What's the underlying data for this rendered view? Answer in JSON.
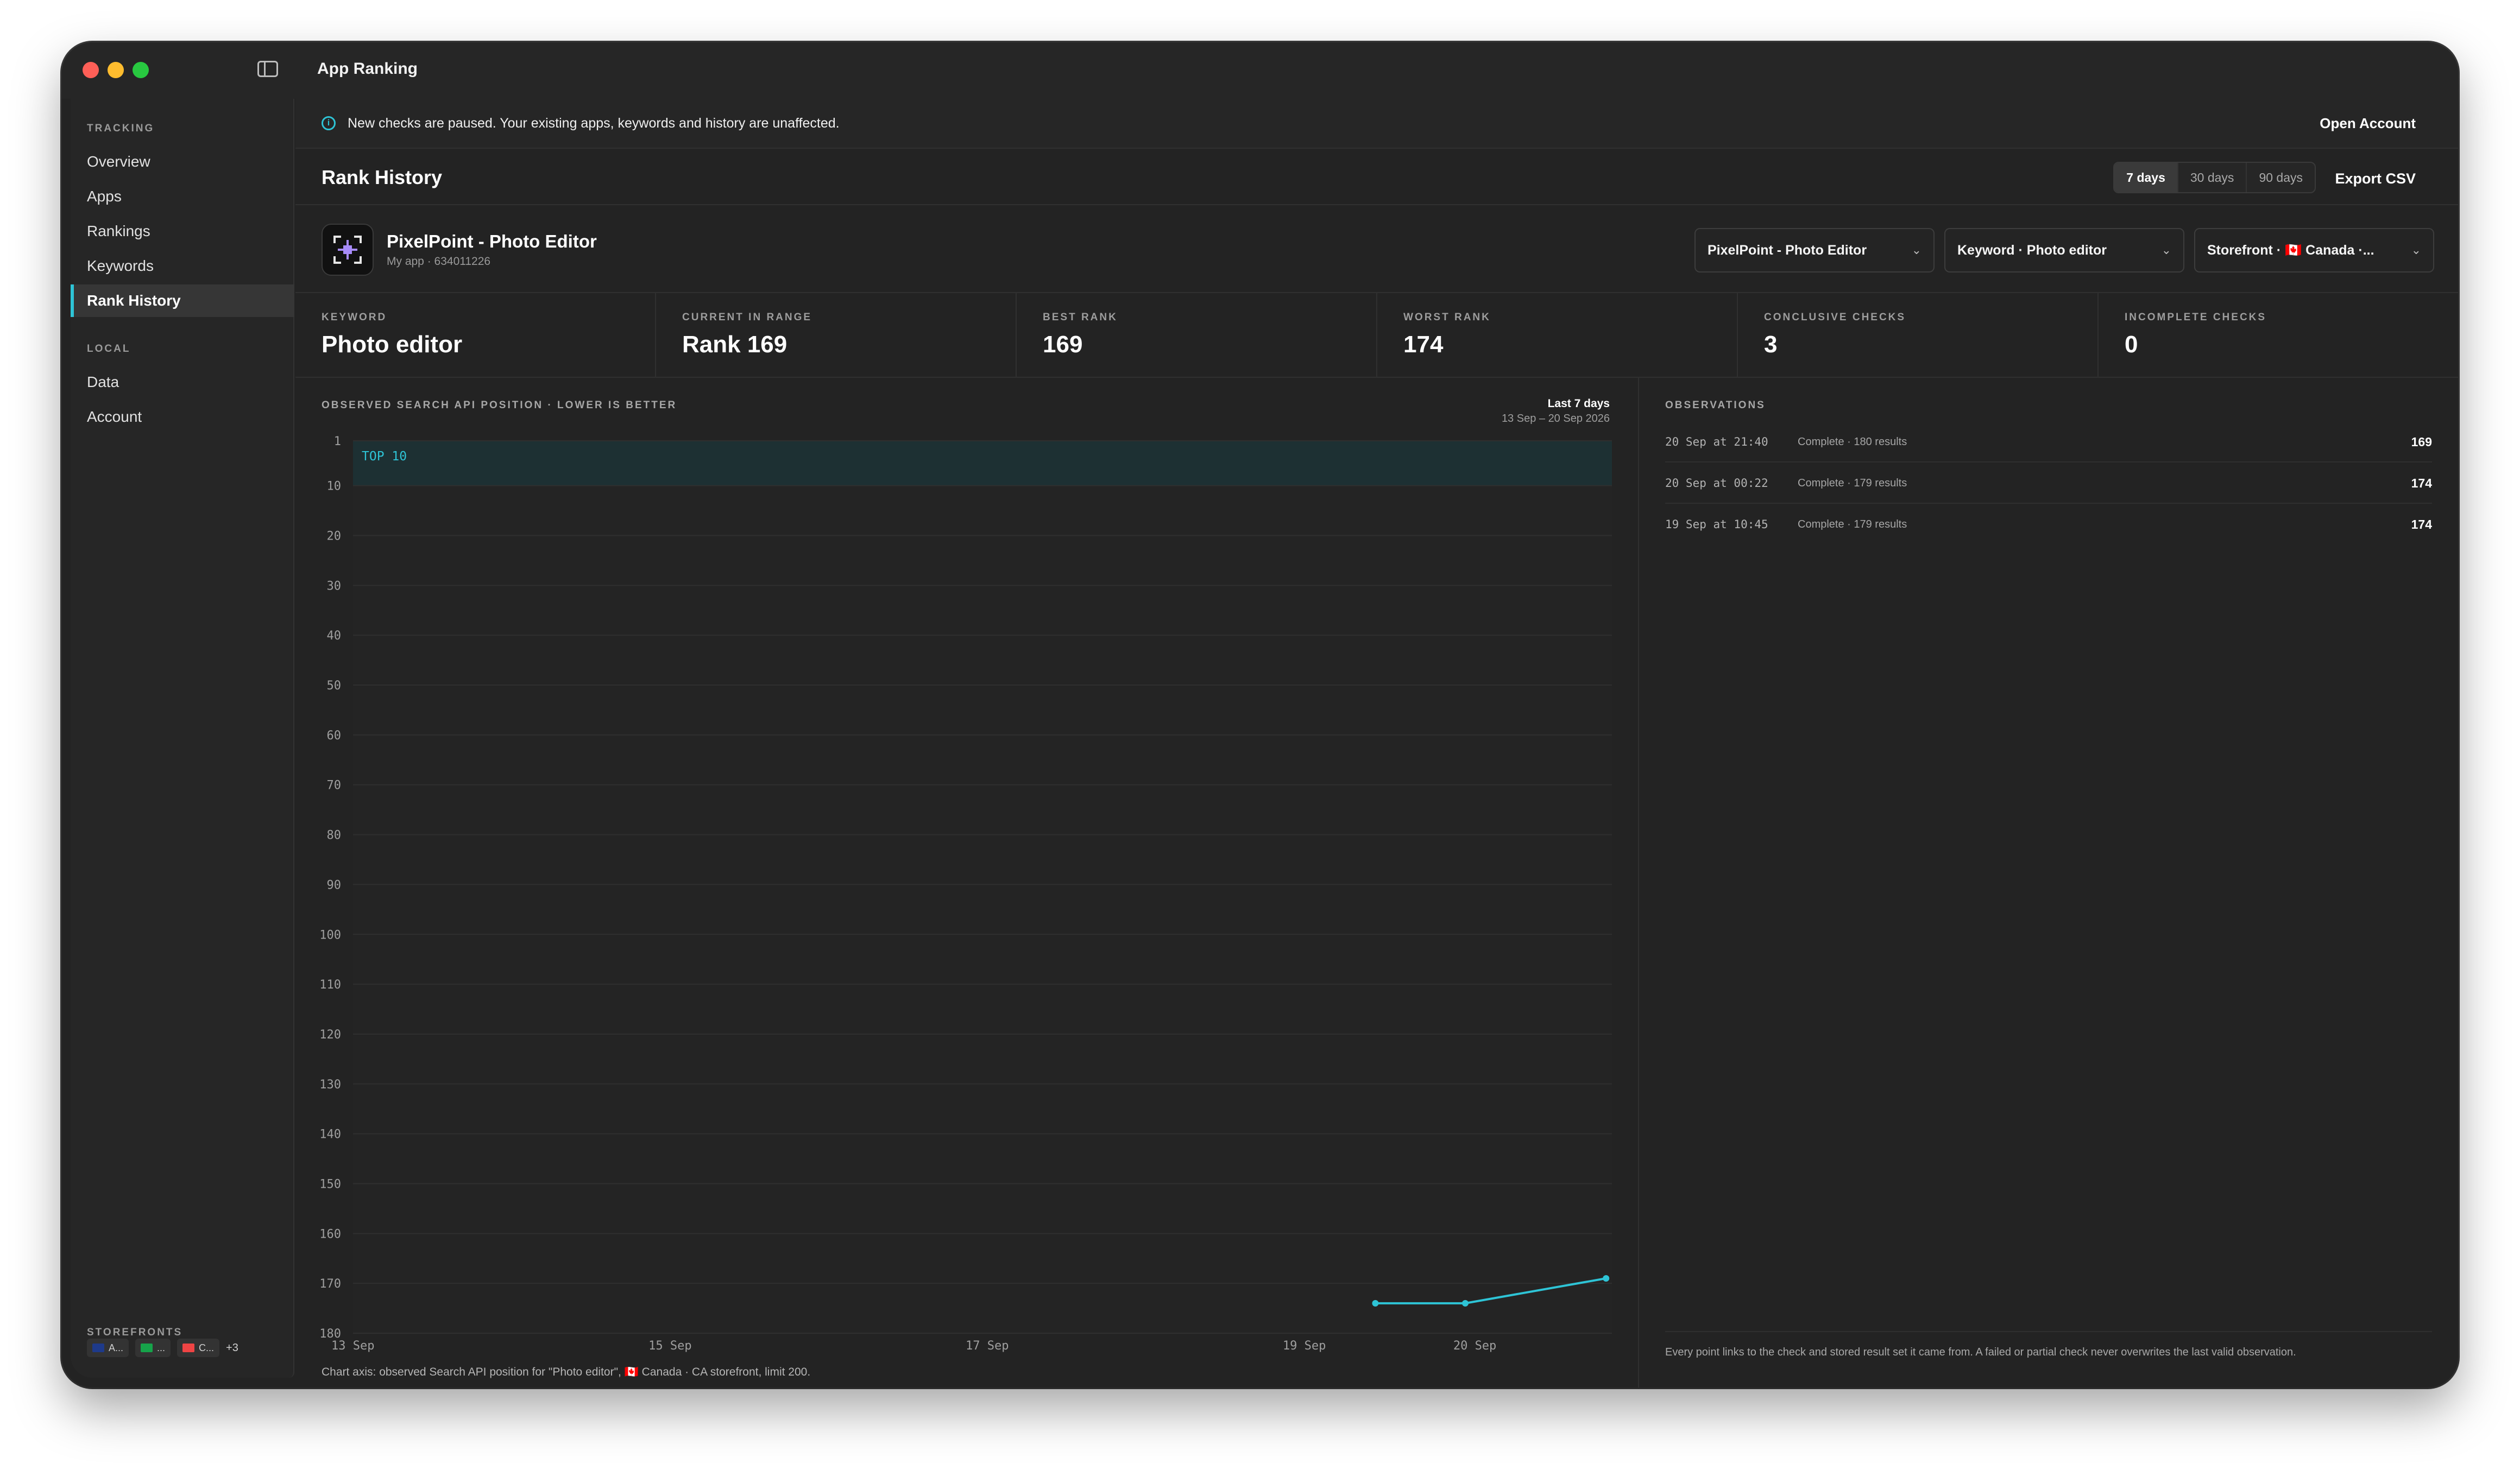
{
  "window": {
    "title": "App Ranking"
  },
  "sidebar": {
    "tracking_header": "TRACKING",
    "tracking_items": [
      {
        "label": "Overview"
      },
      {
        "label": "Apps"
      },
      {
        "label": "Rankings"
      },
      {
        "label": "Keywords"
      },
      {
        "label": "Rank History"
      }
    ],
    "active_item": "Rank History",
    "local_header": "LOCAL",
    "local_items": [
      {
        "label": "Data"
      },
      {
        "label": "Account"
      }
    ],
    "storefronts_header": "STOREFRONTS",
    "storefronts": [
      {
        "label": "A..."
      },
      {
        "label": "..."
      },
      {
        "label": "C..."
      }
    ],
    "storefronts_more": "+3"
  },
  "banner": {
    "message": "New checks are paused. Your existing apps, keywords and history are unaffected.",
    "action_label": "Open Account"
  },
  "header": {
    "title": "Rank History",
    "ranges": [
      {
        "label": "7 days",
        "selected": true
      },
      {
        "label": "30 days",
        "selected": false
      },
      {
        "label": "90 days",
        "selected": false
      }
    ],
    "export_label": "Export CSV"
  },
  "app": {
    "name": "PixelPoint - Photo Editor",
    "subtitle": "My app · 634011226",
    "app_select": "PixelPoint - Photo Editor",
    "keyword_select": "Keyword · Photo editor",
    "storefront_select": "Storefront · 🇨🇦 Canada ·..."
  },
  "stats": [
    {
      "label": "KEYWORD",
      "value": "Photo editor"
    },
    {
      "label": "CURRENT IN RANGE",
      "value": "Rank 169"
    },
    {
      "label": "BEST RANK",
      "value": "169"
    },
    {
      "label": "WORST RANK",
      "value": "174"
    },
    {
      "label": "CONCLUSIVE CHECKS",
      "value": "3"
    },
    {
      "label": "INCOMPLETE CHECKS",
      "value": "0"
    }
  ],
  "chart": {
    "caption": "OBSERVED SEARCH API POSITION · LOWER IS BETTER",
    "range_title": "Last 7 days",
    "range_dates": "13 Sep – 20 Sep 2026",
    "band_label": "TOP 10",
    "footnote": "Chart axis: observed Search API position for \"Photo editor\", 🇨🇦 Canada · CA storefront, limit 200."
  },
  "chart_data": {
    "type": "line",
    "title": "",
    "xlabel": "",
    "ylabel": "",
    "y_inverted": true,
    "ylim": [
      1,
      180
    ],
    "y_ticks": [
      1,
      10,
      20,
      30,
      40,
      50,
      60,
      70,
      80,
      90,
      100,
      110,
      120,
      130,
      140,
      150,
      160,
      170,
      180
    ],
    "x_range_days": [
      13,
      20
    ],
    "x_ticks": [
      {
        "day": 13,
        "label": "13 Sep"
      },
      {
        "day": 15,
        "label": "15 Sep"
      },
      {
        "day": 17,
        "label": "17 Sep"
      },
      {
        "day": 19,
        "label": "19 Sep"
      },
      {
        "day": 20,
        "label": "20 Sep"
      }
    ],
    "band": {
      "from": 1,
      "to": 10,
      "label": "TOP 10"
    },
    "series": [
      {
        "points": [
          {
            "x": "19 Sep 10:45",
            "day": 19.448,
            "y": 174
          },
          {
            "x": "20 Sep 00:22",
            "day": 20.015,
            "y": 174
          },
          {
            "x": "20 Sep 21:40",
            "day": 20.903,
            "y": 169
          }
        ]
      }
    ],
    "line_color": "#2ec4d6"
  },
  "observations": {
    "title": "OBSERVATIONS",
    "rows": [
      {
        "date": "20 Sep at 21:40",
        "status": "Complete · 180 results",
        "rank": "169"
      },
      {
        "date": "20 Sep at 00:22",
        "status": "Complete · 179 results",
        "rank": "174"
      },
      {
        "date": "19 Sep at 10:45",
        "status": "Complete · 179 results",
        "rank": "174"
      }
    ],
    "note": "Every point links to the check and stored result set it came from. A failed or partial check never overwrites the last valid observation."
  }
}
